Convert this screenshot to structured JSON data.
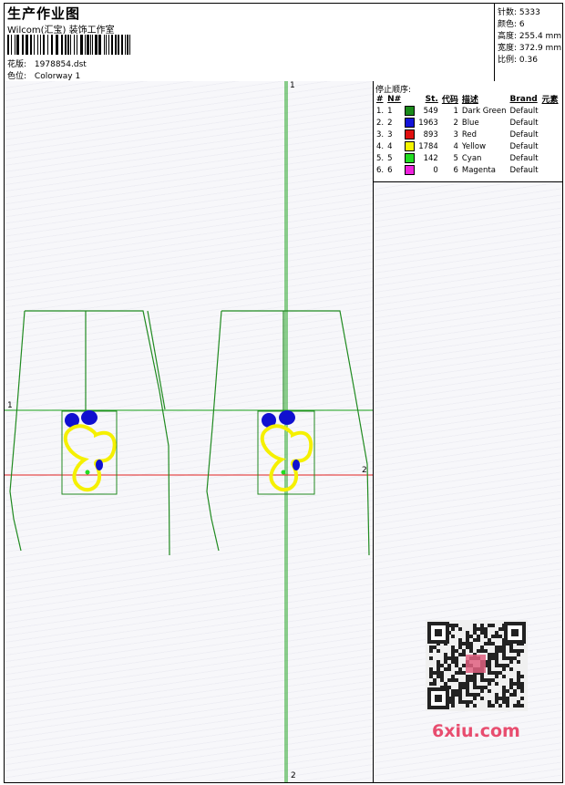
{
  "header": {
    "title": "生产作业图",
    "subtitle": "Wilcom(汇宝) 装饰工作室",
    "design_label": "花版:",
    "design_value": "1978854.dst",
    "colorway_label": "色位:",
    "colorway_value": "Colorway 1"
  },
  "stats": [
    {
      "label": "针数:",
      "value": "5333"
    },
    {
      "label": "颜色:",
      "value": "6"
    },
    {
      "label": "高度:",
      "value": "255.4 mm"
    },
    {
      "label": "宽度:",
      "value": "372.9 mm"
    },
    {
      "label": "比例:",
      "value": "0.36"
    }
  ],
  "stop_sequence": {
    "title": "停止顺序:",
    "headers": [
      "#",
      "N#",
      "St.",
      "代码",
      "描述",
      "Brand",
      "元素"
    ],
    "rows": [
      {
        "num": "1.",
        "n": "1",
        "st": "549",
        "code": "1",
        "desc": "Dark Green",
        "brand": "Default",
        "color": "#1a8a1a"
      },
      {
        "num": "2.",
        "n": "2",
        "st": "1963",
        "code": "2",
        "desc": "Blue",
        "brand": "Default",
        "color": "#1414d8"
      },
      {
        "num": "3.",
        "n": "3",
        "st": "893",
        "code": "3",
        "desc": "Red",
        "brand": "Default",
        "color": "#e01010"
      },
      {
        "num": "4.",
        "n": "4",
        "st": "1784",
        "code": "4",
        "desc": "Yellow",
        "brand": "Default",
        "color": "#f5f500"
      },
      {
        "num": "5.",
        "n": "5",
        "st": "142",
        "code": "5",
        "desc": "Cyan",
        "brand": "Default",
        "color": "#22dd22"
      },
      {
        "num": "6.",
        "n": "6",
        "st": "0",
        "code": "6",
        "desc": "Magenta",
        "brand": "Default",
        "color": "#ee22dd"
      }
    ]
  },
  "markers": {
    "top": "1",
    "left": "1",
    "right": "2",
    "bottom": "2"
  },
  "watermark": "6xiu.com",
  "colors": {
    "green_line": "#1aa01a",
    "red_line": "#e02020",
    "outline": "#208a20",
    "yellow": "#f5f000",
    "blue": "#1010d0"
  }
}
